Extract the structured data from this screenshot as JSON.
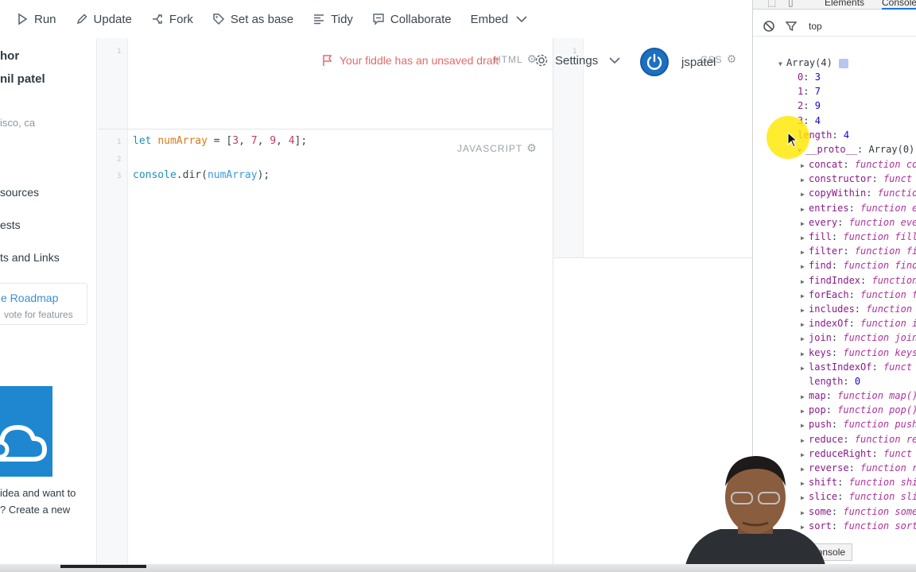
{
  "toolbar": {
    "run": "Run",
    "update": "Update",
    "fork": "Fork",
    "set_as_base": "Set as base",
    "tidy": "Tidy",
    "collaborate": "Collaborate",
    "embed": "Embed"
  },
  "sidebar": {
    "author_heading": "hor",
    "author_name": "nil patel",
    "location": "isco, ca",
    "resources": "sources",
    "requests": "ests",
    "links": "ts and Links",
    "roadmap_link": "e Roadmap",
    "roadmap_sub": "vote for features",
    "promo_line1": "idea and want to",
    "promo_line2": "? Create a new"
  },
  "header": {
    "unsaved_notice": "Your fiddle has an unsaved draft",
    "settings_label": "Settings",
    "username": "jspatel"
  },
  "panels": {
    "html_label": "HTML",
    "css_label": "CSS",
    "js_label": "JAVASCRIPT",
    "html_line_numbers": [
      "1"
    ],
    "css_line_numbers": [
      "1"
    ],
    "js_line_numbers": [
      "1",
      "2",
      "3"
    ],
    "js_code": {
      "line1_kw": "let",
      "line1_var": "numArray",
      "line1_eq": " = [",
      "line1_n1": "3",
      "line1_n2": "7",
      "line1_n3": "9",
      "line1_n4": "4",
      "line1_end": "];",
      "line3_console": "console",
      "line3_method": ".dir(",
      "line3_arg": "numArray",
      "line3_end": ");"
    }
  },
  "devtools": {
    "tab_elements": "Elements",
    "tab_console": "Console",
    "context": "top",
    "console_drawer_tab": "Console",
    "array_header": "Array(4)",
    "entries": [
      {
        "key": "0",
        "value": "3"
      },
      {
        "key": "1",
        "value": "7"
      },
      {
        "key": "2",
        "value": "9"
      },
      {
        "key": "3",
        "value": "4"
      }
    ],
    "length_key": "length",
    "length_value": "4",
    "proto_key": "__proto__",
    "proto_value": "Array(0)",
    "methods": [
      {
        "name": "concat",
        "preview": "function co"
      },
      {
        "name": "constructor",
        "preview": "funct"
      },
      {
        "name": "copyWithin",
        "preview": "functio"
      },
      {
        "name": "entries",
        "preview": "function e"
      },
      {
        "name": "every",
        "preview": "function eve"
      },
      {
        "name": "fill",
        "preview": "function fill"
      },
      {
        "name": "filter",
        "preview": "function fi"
      },
      {
        "name": "find",
        "preview": "function find"
      },
      {
        "name": "findIndex",
        "preview": "function"
      },
      {
        "name": "forEach",
        "preview": "function f"
      },
      {
        "name": "includes",
        "preview": "function"
      },
      {
        "name": "indexOf",
        "preview": "function i"
      },
      {
        "name": "join",
        "preview": "function join"
      },
      {
        "name": "keys",
        "preview": "function keys"
      },
      {
        "name": "lastIndexOf",
        "preview": "funct"
      }
    ],
    "proto_length_key": "length",
    "proto_length_value": "0",
    "methods2": [
      {
        "name": "map",
        "preview": "function map()"
      },
      {
        "name": "pop",
        "preview": "function pop()"
      },
      {
        "name": "push",
        "preview": "function push"
      },
      {
        "name": "reduce",
        "preview": "function re"
      },
      {
        "name": "reduceRight",
        "preview": "funct"
      },
      {
        "name": "reverse",
        "preview": "function r"
      },
      {
        "name": "shift",
        "preview": "function shi"
      },
      {
        "name": "slice",
        "preview": "function sli"
      },
      {
        "name": "some",
        "preview": "function some"
      },
      {
        "name": "sort",
        "preview": "function sort"
      }
    ]
  },
  "colors": {
    "accent": "#1c6fc2",
    "warning": "#e46a6a",
    "cursor_highlight": "#ffe800"
  }
}
